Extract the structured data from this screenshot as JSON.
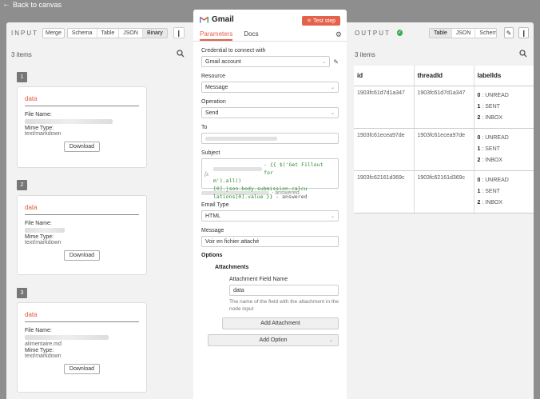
{
  "nav": {
    "back_label": "Back to canvas"
  },
  "input": {
    "title": "INPUT",
    "merge_label": "Merge",
    "views": [
      "Schema",
      "Table",
      "JSON",
      "Binary"
    ],
    "active_view": "Binary",
    "count_label": "3 items",
    "items": [
      {
        "num": "1",
        "title": "data",
        "file_name_label": "File Name:",
        "file_name_value": "",
        "mime_label": "Mime Type:",
        "mime_value": "text/markdown",
        "download": "Download"
      },
      {
        "num": "2",
        "title": "data",
        "file_name_label": "File Name:",
        "file_name_value": "",
        "mime_label": "Mime Type:",
        "mime_value": "text/markdown",
        "download": "Download"
      },
      {
        "num": "3",
        "title": "data",
        "file_name_label": "File Name:",
        "file_name_value": "alimentaire.md",
        "mime_label": "Mime Type:",
        "mime_value": "text/markdown",
        "download": "Download"
      }
    ]
  },
  "node": {
    "name": "Gmail",
    "test_step": "Test step",
    "tabs": [
      "Parameters",
      "Docs"
    ],
    "credential_label": "Credential to connect with",
    "credential_value": "Gmail account",
    "resource_label": "Resource",
    "resource_value": "Message",
    "operation_label": "Operation",
    "operation_value": "Send",
    "to_label": "To",
    "subject_label": "Subject",
    "subject_expr_1": " - {{ $('Get Fillout for",
    "subject_expr_2": "m').all()[0].json.body.submission.calcu",
    "subject_expr_3": "lations[0].value }}",
    "subject_suffix": " - answered",
    "subject_preview_suffix": "- answered",
    "email_type_label": "Email Type",
    "email_type_value": "HTML",
    "message_label": "Message",
    "message_value": "Voir en fichier attaché",
    "options_label": "Options",
    "attachments_label": "Attachments",
    "attachment_field_label": "Attachment Field Name",
    "attachment_field_value": "data",
    "attachment_hint": "The name of the field with the attachment in the node input",
    "add_attachment": "Add Attachment",
    "add_option": "Add Option"
  },
  "output": {
    "title": "OUTPUT",
    "views": [
      "Table",
      "JSON",
      "Schema"
    ],
    "active_view": "Table",
    "count_label": "3 items",
    "columns": [
      "id",
      "threadId",
      "labelIds"
    ],
    "rows": [
      {
        "id": "1903fc61d7d1a347",
        "threadId": "1903fc61d7d1a347",
        "labels": [
          [
            "0",
            "UNREAD"
          ],
          [
            "1",
            "SENT"
          ],
          [
            "2",
            "INBOX"
          ]
        ]
      },
      {
        "id": "1903fc61ecea97de",
        "threadId": "1903fc61ecea97de",
        "labels": [
          [
            "0",
            "UNREAD"
          ],
          [
            "1",
            "SENT"
          ],
          [
            "2",
            "INBOX"
          ]
        ]
      },
      {
        "id": "1903fc62161d369c",
        "threadId": "1903fc62161d369c",
        "labels": [
          [
            "0",
            "UNREAD"
          ],
          [
            "1",
            "SENT"
          ],
          [
            "2",
            "INBOX"
          ]
        ]
      }
    ]
  },
  "colors": {
    "accent": "#e4614b",
    "success": "#3aaa55"
  }
}
